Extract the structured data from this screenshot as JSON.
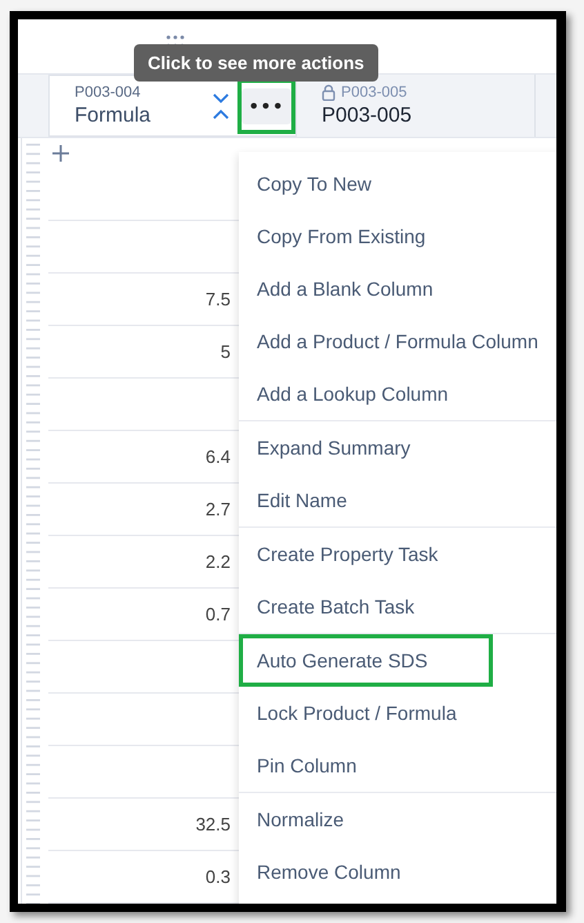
{
  "tooltip": {
    "text": "Click to see more actions"
  },
  "columns": [
    {
      "code": "P003-004",
      "name": "Formula",
      "locked": false,
      "more_button": {
        "label": "•••",
        "highlighted": true
      }
    },
    {
      "code": "P003-005",
      "name": "P003-005",
      "locked": true
    }
  ],
  "rows": [
    {
      "value": ""
    },
    {
      "value": ""
    },
    {
      "value": "7.5"
    },
    {
      "value": "5"
    },
    {
      "value": ""
    },
    {
      "value": "6.4"
    },
    {
      "value": "2.7"
    },
    {
      "value": "2.2"
    },
    {
      "value": "0.7"
    },
    {
      "value": ""
    },
    {
      "value": ""
    },
    {
      "value": ""
    },
    {
      "value": "32.5"
    },
    {
      "value": "0.3"
    }
  ],
  "menu": {
    "groups": [
      {
        "items": [
          {
            "label": "Copy To New",
            "highlighted": false
          },
          {
            "label": "Copy From Existing",
            "highlighted": false
          },
          {
            "label": "Add a Blank Column",
            "highlighted": false
          },
          {
            "label": "Add a Product / Formula Column",
            "highlighted": false
          },
          {
            "label": "Add a Lookup Column",
            "highlighted": false
          }
        ]
      },
      {
        "items": [
          {
            "label": "Expand Summary",
            "highlighted": false
          },
          {
            "label": "Edit Name",
            "highlighted": false
          }
        ]
      },
      {
        "items": [
          {
            "label": "Create Property Task",
            "highlighted": false
          },
          {
            "label": "Create Batch Task",
            "highlighted": false
          }
        ]
      },
      {
        "items": [
          {
            "label": "Auto Generate SDS",
            "highlighted": true
          },
          {
            "label": "Lock Product / Formula",
            "highlighted": false
          },
          {
            "label": "Pin Column",
            "highlighted": false
          }
        ]
      },
      {
        "items": [
          {
            "label": "Normalize",
            "highlighted": false
          },
          {
            "label": "Remove Column",
            "highlighted": false
          }
        ]
      }
    ]
  }
}
